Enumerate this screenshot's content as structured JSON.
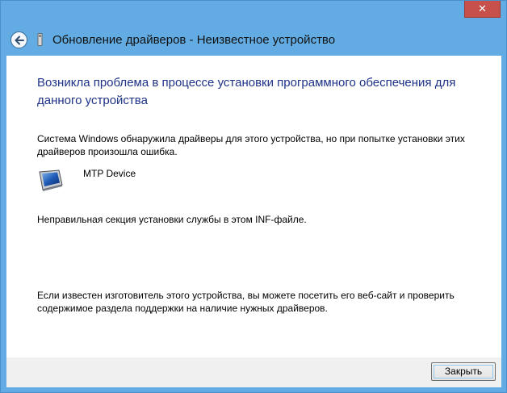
{
  "window": {
    "close_glyph": "✕",
    "header_title": "Обновление драйверов - Неизвестное устройство"
  },
  "content": {
    "heading": "Возникла проблема в процессе установки программного обеспечения для данного устройства",
    "paragraph1": "Система Windows обнаружила драйверы для этого устройства, но при попытке установки этих драйверов произошла ошибка.",
    "device_name": "MTP Device",
    "paragraph2": "Неправильная секция установки службы в этом INF-файле.",
    "paragraph3": "Если известен изготовитель этого устройства, вы можете посетить его веб-сайт и проверить содержимое раздела поддержки на наличие нужных драйверов."
  },
  "footer": {
    "close_label": "Закрыть"
  },
  "icons": {
    "back": "back-arrow-icon",
    "device_small": "usb-device-icon",
    "device": "mtp-device-icon"
  },
  "colors": {
    "frame": "#62abe3",
    "heading": "#1e3287",
    "close_button": "#c7504a"
  }
}
